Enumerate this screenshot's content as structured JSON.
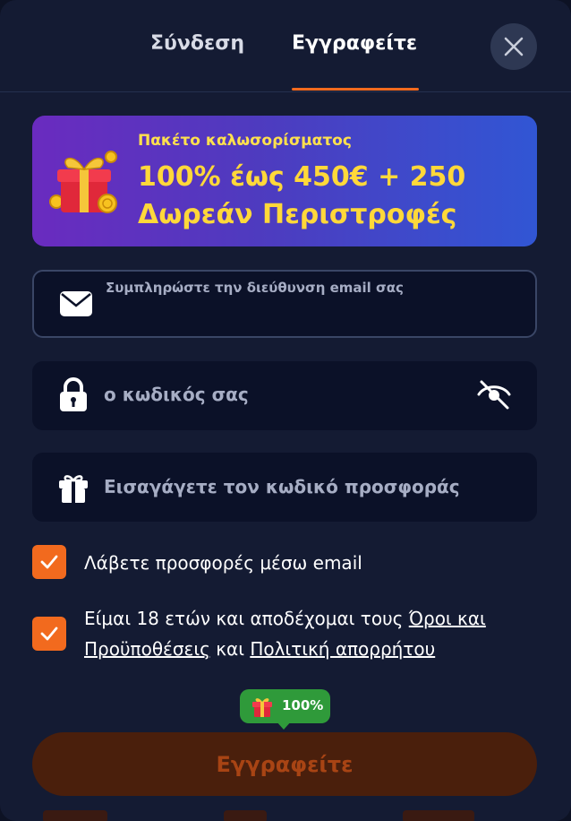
{
  "tabs": {
    "login": "Σύνδεση",
    "register": "Εγγραφείτε",
    "active": "register"
  },
  "banner": {
    "subtitle": "Πακέτο καλωσορίσματος",
    "line1": "100% έως 450€ + 250",
    "line2": "Δωρεάν Περιστροφές",
    "icon": "gift-icon"
  },
  "form": {
    "email_label": "Συμπληρώστε την διεύθυνση email σας",
    "email_value": "",
    "password_placeholder": "ο κωδικός σας",
    "promo_placeholder": "Εισαγάγετε τον κωδικό προσφοράς"
  },
  "checkboxes": {
    "offers": {
      "checked": true,
      "label": "Λάβετε προσφορές μέσω email"
    },
    "terms": {
      "checked": true,
      "prefix": "Είμαι 18 ετών και αποδέχομαι τους ",
      "terms_link": "Όροι και Προϋποθέσεις",
      "middle": " και ",
      "privacy_link": "Πολιτική απορρήτου"
    }
  },
  "progress_badge": {
    "text": "100%",
    "value": 100
  },
  "submit": {
    "label": "Εγγραφείτε"
  },
  "colors": {
    "accent": "#f26a1e",
    "banner_text": "#ffd83a",
    "badge": "#2f9a3a",
    "background": "#141b33"
  }
}
